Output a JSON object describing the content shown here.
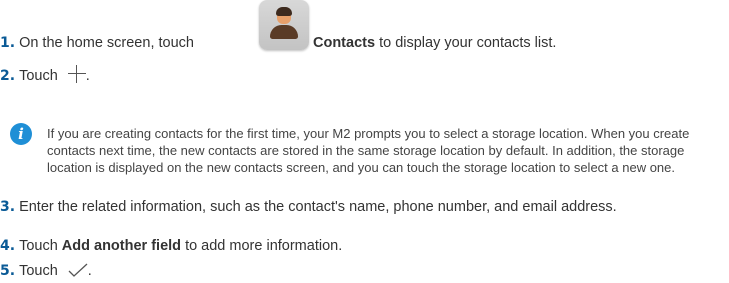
{
  "steps": [
    {
      "number": "1.",
      "pre": "On the home screen, touch",
      "bold": "Contacts",
      "post": "to display your contacts list."
    },
    {
      "number": "2.",
      "text": "Touch",
      "suffix": "."
    },
    {
      "number": "3.",
      "text": "Enter the related information, such as the contact's name, phone number, and email address."
    },
    {
      "number": "4.",
      "pre": "Touch",
      "bold": "Add another field",
      "post": "to add more information."
    },
    {
      "number": "5.",
      "text": "Touch",
      "suffix": "."
    }
  ],
  "note": {
    "icon": "info-icon",
    "text": "If you are creating contacts for the first time, your M2 prompts you to select a storage location. When you create contacts next time, the new contacts are stored in the same storage location by default. In addition, the storage location is displayed on the new contacts screen, and you can touch the storage location to select a new one."
  },
  "icons": {
    "contacts": "contacts-app-icon",
    "add": "plus-icon",
    "confirm": "check-icon"
  },
  "colors": {
    "step_number": "#0a5a96",
    "info": "#1f8fd6"
  }
}
